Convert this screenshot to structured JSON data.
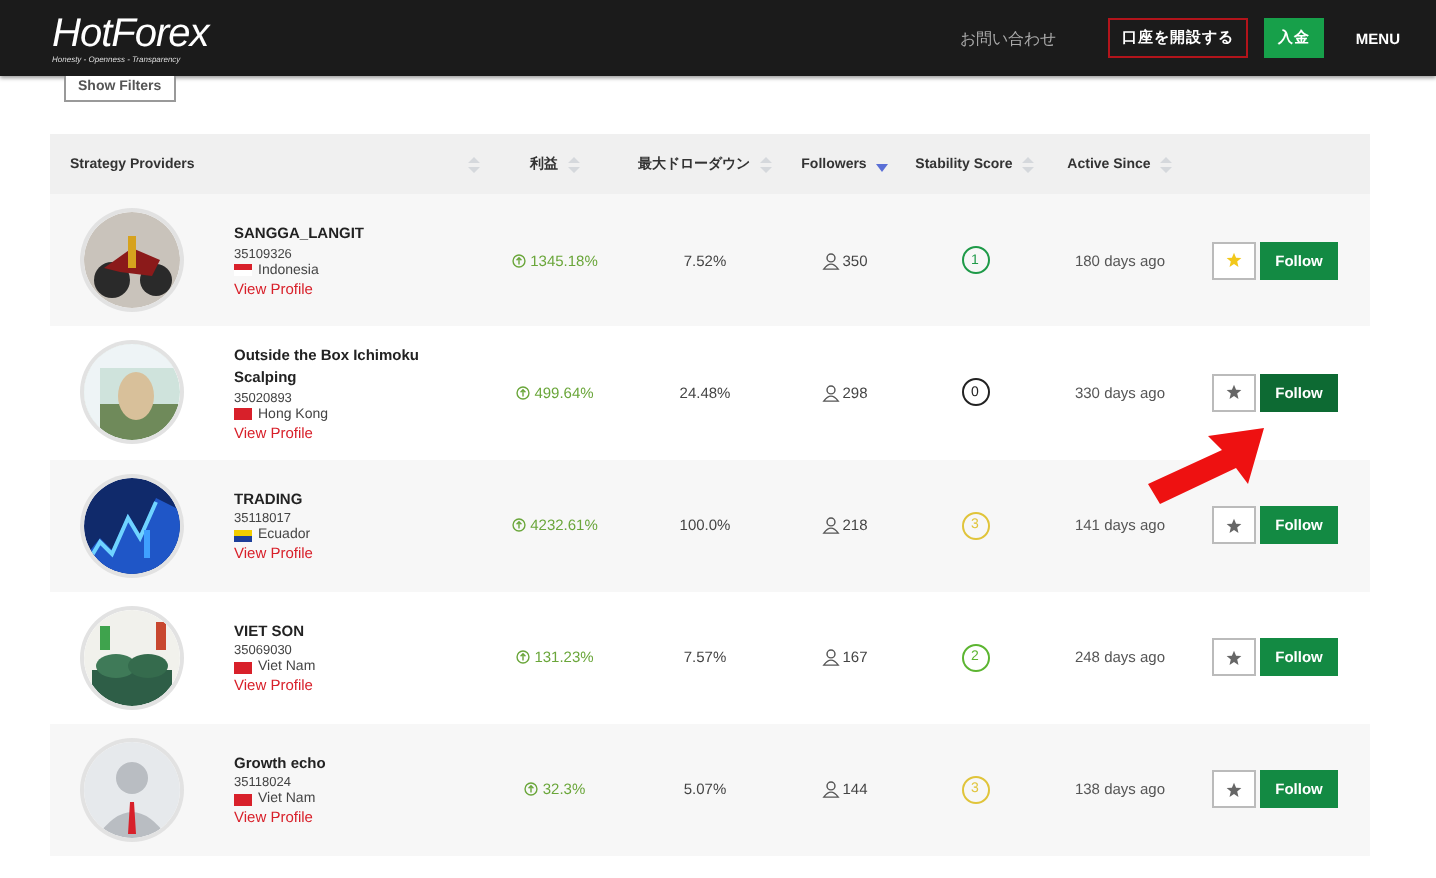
{
  "header": {
    "logo": "HotForex",
    "tagline": "Honesty - Openness - Transparency",
    "nav": [
      {
        "label": "お問い合わせ",
        "kind": "link"
      },
      {
        "label": "口座を開設する",
        "kind": "outline"
      },
      {
        "label": "入金",
        "kind": "solid"
      },
      {
        "label": "MENU",
        "kind": "menu"
      }
    ]
  },
  "filters_button": "Show Filters",
  "table": {
    "columns": [
      {
        "label": "Strategy Providers",
        "sorted": false
      },
      {
        "label": "利益",
        "sorted": false
      },
      {
        "label": "最大ドローダウン",
        "sorted": false
      },
      {
        "label": "Followers",
        "sorted": true
      },
      {
        "label": "Stability Score",
        "sorted": false
      },
      {
        "label": "Active Since",
        "sorted": false
      }
    ],
    "rows": [
      {
        "name": "SANGGA_LANGIT",
        "account": "35109326",
        "country": "Indonesia",
        "link": "View Profile",
        "profit": "1345.18%",
        "drawdown": "7.52%",
        "followers": "350",
        "score": "1",
        "color": "#1e9a48",
        "active": "180 days ago",
        "starred": true,
        "follow": "Follow",
        "hovered": false
      },
      {
        "name": "Outside the Box Ichimoku Scalping",
        "account": "35020893",
        "country": "Hong Kong",
        "link": "View Profile",
        "profit": "499.64%",
        "drawdown": "24.48%",
        "followers": "298",
        "score": "0",
        "color": "#222222",
        "active": "330 days ago",
        "starred": false,
        "follow": "Follow",
        "hovered": true
      },
      {
        "name": "TRADING",
        "account": "35118017",
        "country": "Ecuador",
        "link": "View Profile",
        "profit": "4232.61%",
        "drawdown": "100.0%",
        "followers": "218",
        "score": "3",
        "color": "#e0c43a",
        "active": "141 days ago",
        "starred": false,
        "follow": "Follow",
        "hovered": false
      },
      {
        "name": "VIET SON",
        "account": "35069030",
        "country": "Viet Nam",
        "link": "View Profile",
        "profit": "131.23%",
        "drawdown": "7.57%",
        "followers": "167",
        "score": "2",
        "color": "#5cb531",
        "active": "248 days ago",
        "starred": false,
        "follow": "Follow",
        "hovered": false
      },
      {
        "name": "Growth echo",
        "account": "35118024",
        "country": "Viet Nam",
        "link": "View Profile",
        "profit": "32.3%",
        "drawdown": "5.07%",
        "followers": "144",
        "score": "3",
        "color": "#e0c43a",
        "active": "138 days ago",
        "starred": false,
        "follow": "Follow",
        "hovered": false
      }
    ]
  }
}
